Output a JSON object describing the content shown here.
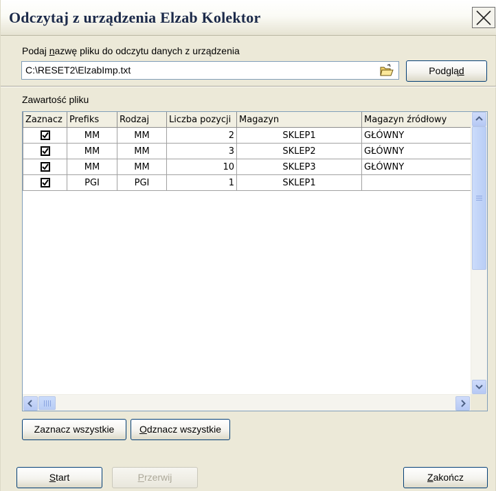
{
  "window": {
    "title": "Odczytaj z urządzenia Elzab Kolektor"
  },
  "file": {
    "label_pre": "Podaj ",
    "label_accel": "n",
    "label_post": "azwę pliku do odczytu danych z urządzenia",
    "path": "C:\\RESET2\\ElzabImp.txt",
    "browse_icon": "folder-open-icon",
    "preview_pre": "Podglą",
    "preview_accel": "d",
    "preview_post": ""
  },
  "content": {
    "label": "Zawartość pliku",
    "columns": [
      "Zaznacz",
      "Prefiks",
      "Rodzaj",
      "Liczba pozycji",
      "Magazyn",
      "Magazyn źródłowy"
    ],
    "rows": [
      {
        "checked": true,
        "prefiks": "MM",
        "rodzaj": "MM",
        "liczba": "2",
        "magazyn": "SKLEP1",
        "zrodlowy": "GŁÓWNY"
      },
      {
        "checked": true,
        "prefiks": "MM",
        "rodzaj": "MM",
        "liczba": "3",
        "magazyn": "SKLEP2",
        "zrodlowy": "GŁÓWNY"
      },
      {
        "checked": true,
        "prefiks": "MM",
        "rodzaj": "MM",
        "liczba": "10",
        "magazyn": "SKLEP3",
        "zrodlowy": "GŁÓWNY"
      },
      {
        "checked": true,
        "prefiks": "PGI",
        "rodzaj": "PGI",
        "liczba": "1",
        "magazyn": "SKLEP1",
        "zrodlowy": ""
      }
    ]
  },
  "buttons": {
    "select_all": "Zaznacz wszystkie",
    "deselect_all_accel": "O",
    "deselect_all_rest": "dznacz wszystkie",
    "start_accel": "S",
    "start_rest": "tart",
    "stop_accel": "P",
    "stop_rest": "rzerwij",
    "close_accel": "Z",
    "close_rest": "akończ"
  },
  "colors": {
    "window_bg": "#ece9d8",
    "accent_border": "#003c74",
    "scrollbar": "#c1d3fb"
  }
}
